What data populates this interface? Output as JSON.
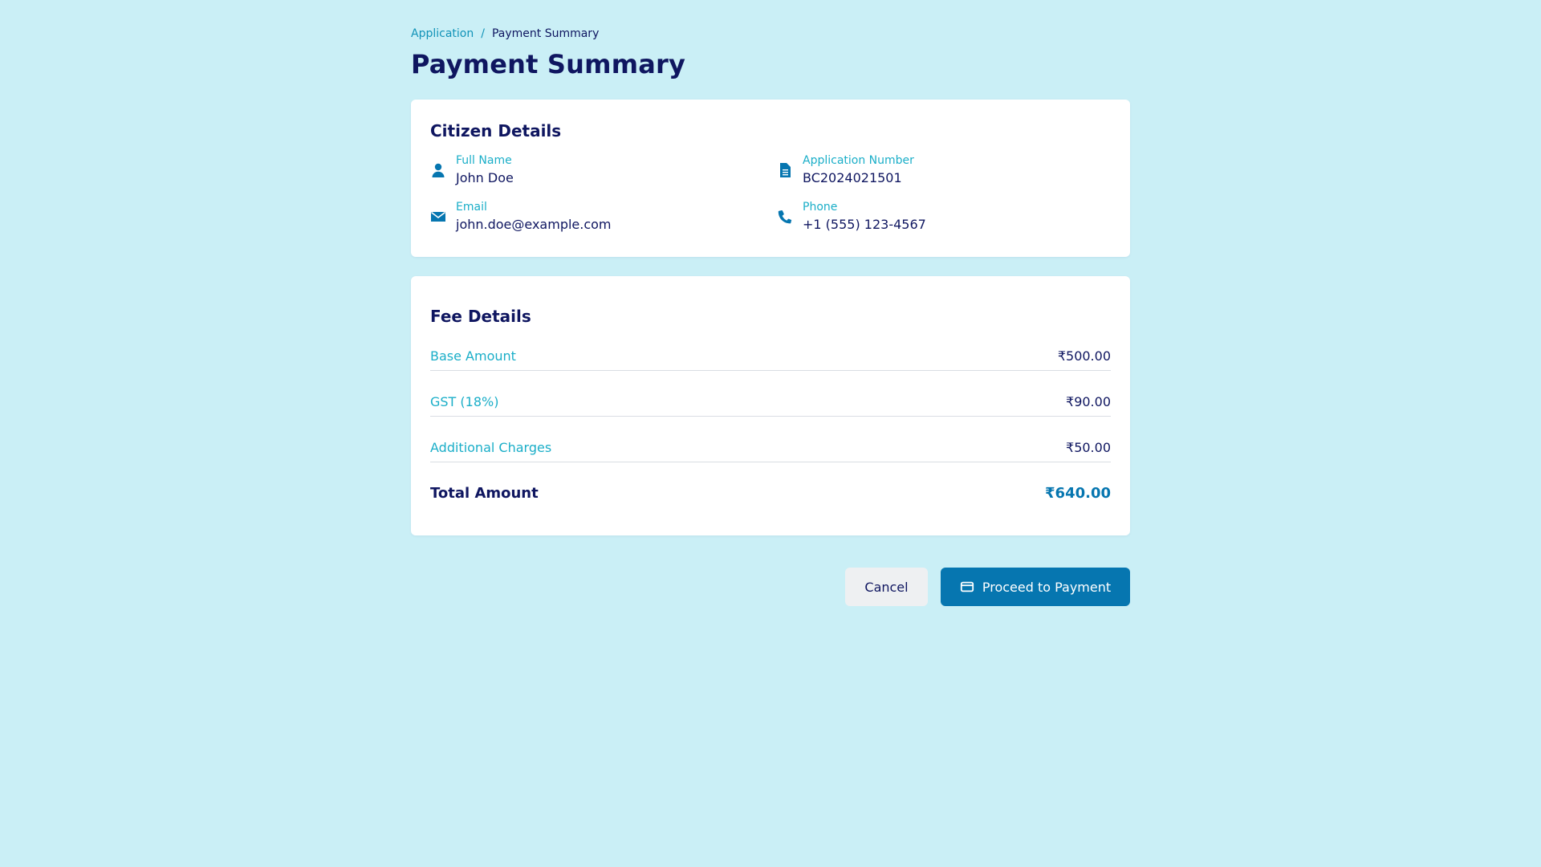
{
  "breadcrumb": {
    "parent": "Application",
    "separator": "/",
    "current": "Payment Summary"
  },
  "page": {
    "title": "Payment Summary"
  },
  "citizen": {
    "title": "Citizen Details",
    "fields": [
      {
        "label": "Full Name",
        "value": "John Doe",
        "icon": "user-icon"
      },
      {
        "label": "Application Number",
        "value": "BC2024021501",
        "icon": "document-icon"
      },
      {
        "label": "Email",
        "value": "john.doe@example.com",
        "icon": "envelope-icon"
      },
      {
        "label": "Phone",
        "value": "+1 (555) 123-4567",
        "icon": "phone-icon"
      }
    ]
  },
  "fees": {
    "title": "Fee Details",
    "items": [
      {
        "label": "Base Amount",
        "amount": "₹500.00"
      },
      {
        "label": "GST (18%)",
        "amount": "₹90.00"
      },
      {
        "label": "Additional Charges",
        "amount": "₹50.00"
      }
    ],
    "total_label": "Total Amount",
    "total_amount": "₹640.00"
  },
  "actions": {
    "cancel_label": "Cancel",
    "proceed_label": "Proceed to Payment",
    "proceed_icon": "credit-card-icon"
  },
  "colors": {
    "background": "#caeff6",
    "primary": "#0676b0",
    "heading": "#0f1660",
    "label": "#1aaec8"
  }
}
